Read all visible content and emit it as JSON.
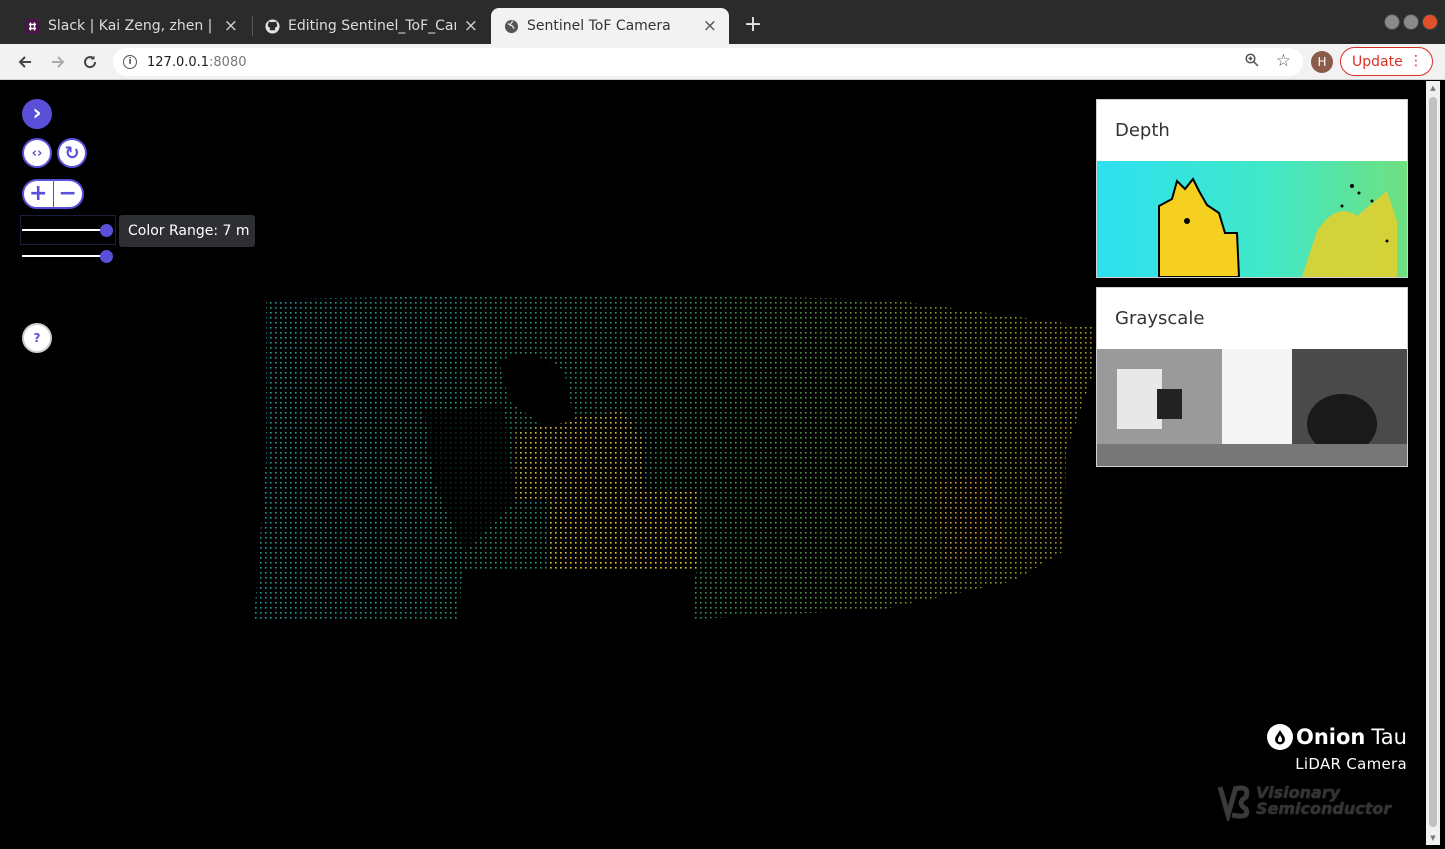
{
  "browser": {
    "tabs": [
      {
        "title": "Slack | Kai Zeng, zhen | Vis",
        "favicon": "slack-icon"
      },
      {
        "title": "Editing Sentinel_ToF_Cam",
        "favicon": "github-icon"
      },
      {
        "title": "Sentinel ToF Camera",
        "favicon": "globe-icon",
        "active": true
      }
    ],
    "new_tab": "+",
    "close_tab": "×",
    "url_host": "127.0.0.1",
    "url_port": ":8080",
    "profile_initial": "H",
    "update_label": "Update",
    "update_menu": "⋮"
  },
  "controls": {
    "toggle_panel": "›",
    "view_code": "‹›",
    "reset": "↻",
    "zoom_in": "+",
    "zoom_out": "−",
    "tooltip": "Color Range: 7 m",
    "help": "?"
  },
  "panels": {
    "depth_title": "Depth",
    "grayscale_title": "Grayscale"
  },
  "branding": {
    "brand_name": "Onion",
    "product": "Tau",
    "subtitle": "LiDAR Camera",
    "company_line1": "Visionary",
    "company_line2": "Semiconductor"
  },
  "colors": {
    "accent": "#5a4fd8",
    "update_red": "#d93025"
  }
}
